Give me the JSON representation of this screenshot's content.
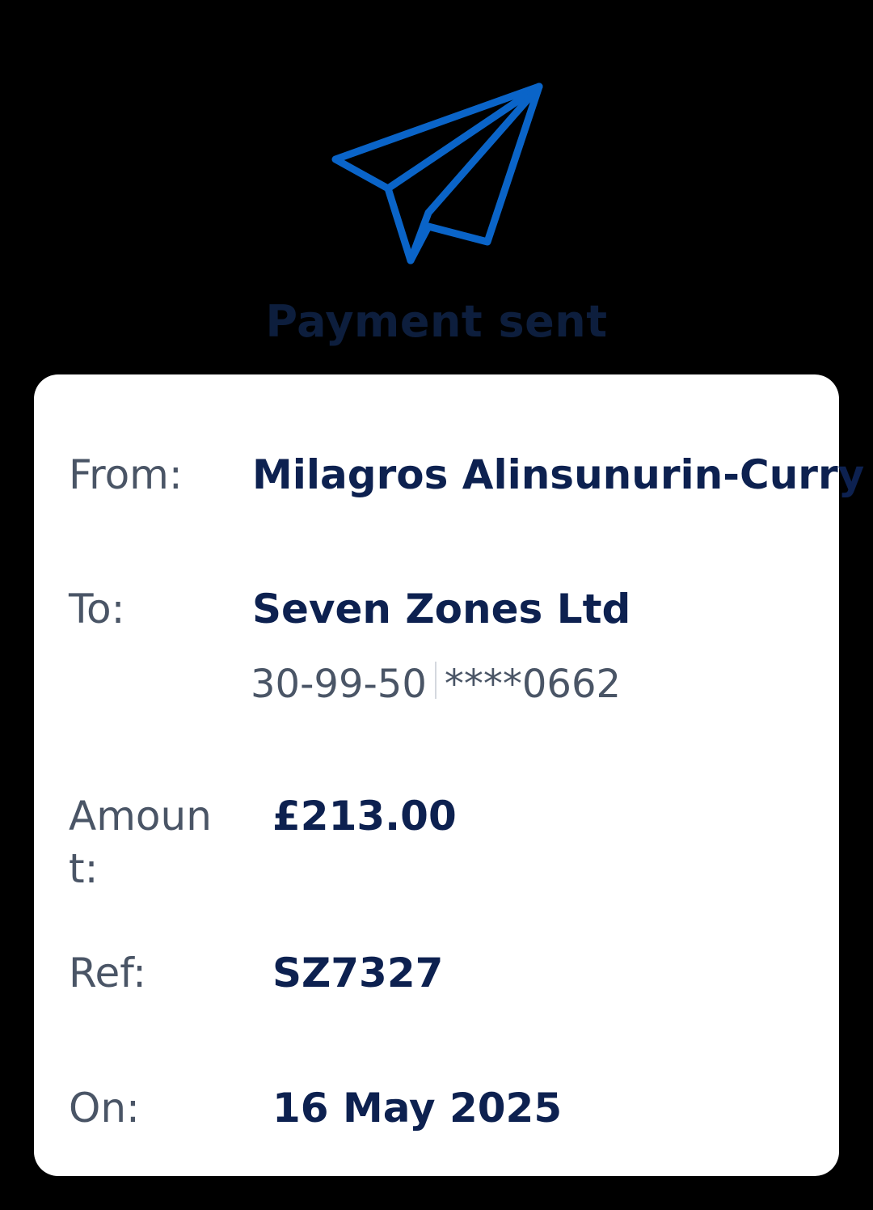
{
  "header": {
    "title": "Payment sent",
    "icon": "paper-plane-icon",
    "icon_color": "#0a64c8"
  },
  "details": {
    "from": {
      "label": "From:",
      "value": "Milagros Alinsunurin-Curry"
    },
    "to": {
      "label": "To:",
      "value": "Seven Zones Ltd",
      "sort_code": "30-99-50",
      "account": "****0662"
    },
    "amount": {
      "label": "Amount:",
      "value": "£213.00"
    },
    "ref": {
      "label": "Ref:",
      "value": "SZ7327"
    },
    "on": {
      "label": "On:",
      "value": "16 May 2025"
    }
  },
  "colors": {
    "background": "#000000",
    "card": "#ffffff",
    "value_text": "#0d2150",
    "label_text": "#4a5566"
  }
}
